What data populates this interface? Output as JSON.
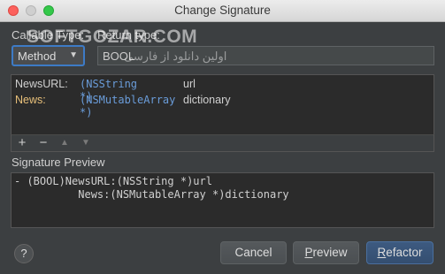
{
  "window": {
    "title": "Change Signature"
  },
  "watermark": {
    "text": "SOFTGOZAR.COM",
    "subtext": "اولین دانلود از فارسی"
  },
  "callable": {
    "label": "Callable Type:",
    "value": "Method"
  },
  "return_type": {
    "label": "Return type:",
    "value": "BOOL"
  },
  "params": {
    "rows": [
      {
        "name": "NewsURL:",
        "type": "(NSString *)",
        "param": "url"
      },
      {
        "name": "News:",
        "type": "(NSMutableArray *)",
        "param": "dictionary"
      }
    ]
  },
  "toolbar": {
    "add": "+",
    "remove": "−",
    "up": "▲",
    "down": "▼"
  },
  "signature_preview": {
    "label": "Signature Preview",
    "line1": "- (BOOL)NewsURL:(NSString *)url",
    "line2": "          News:(NSMutableArray *)dictionary"
  },
  "buttons": {
    "help": "?",
    "cancel": "Cancel",
    "preview_first": "P",
    "preview_rest": "review",
    "refactor_first": "R",
    "refactor_rest": "efactor"
  },
  "colors": {
    "accent": "#3d7bc6",
    "type_blue": "#6a9cd9",
    "name_orange": "#e8c07a"
  }
}
